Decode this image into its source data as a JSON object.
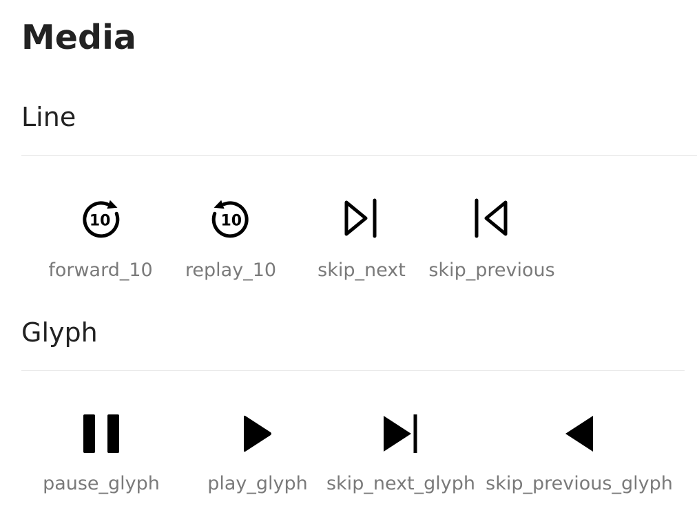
{
  "page": {
    "title": "Media"
  },
  "sections": [
    {
      "title": "Line",
      "icons": [
        {
          "label": "forward_10",
          "icon": "forward-10-icon"
        },
        {
          "label": "replay_10",
          "icon": "replay-10-icon"
        },
        {
          "label": "skip_next",
          "icon": "skip-next-icon"
        },
        {
          "label": "skip_previous",
          "icon": "skip-previous-icon"
        }
      ]
    },
    {
      "title": "Glyph",
      "icons": [
        {
          "label": "pause_glyph",
          "icon": "pause-glyph-icon"
        },
        {
          "label": "play_glyph",
          "icon": "play-glyph-icon"
        },
        {
          "label": "skip_next_glyph",
          "icon": "skip-next-glyph-icon"
        },
        {
          "label": "skip_previous_glyph",
          "icon": "skip-previous-glyph-icon"
        }
      ]
    }
  ],
  "colors": {
    "text": "#222222",
    "label": "#7a7a7a",
    "divider": "#e5e5e5",
    "icon": "#000000"
  }
}
